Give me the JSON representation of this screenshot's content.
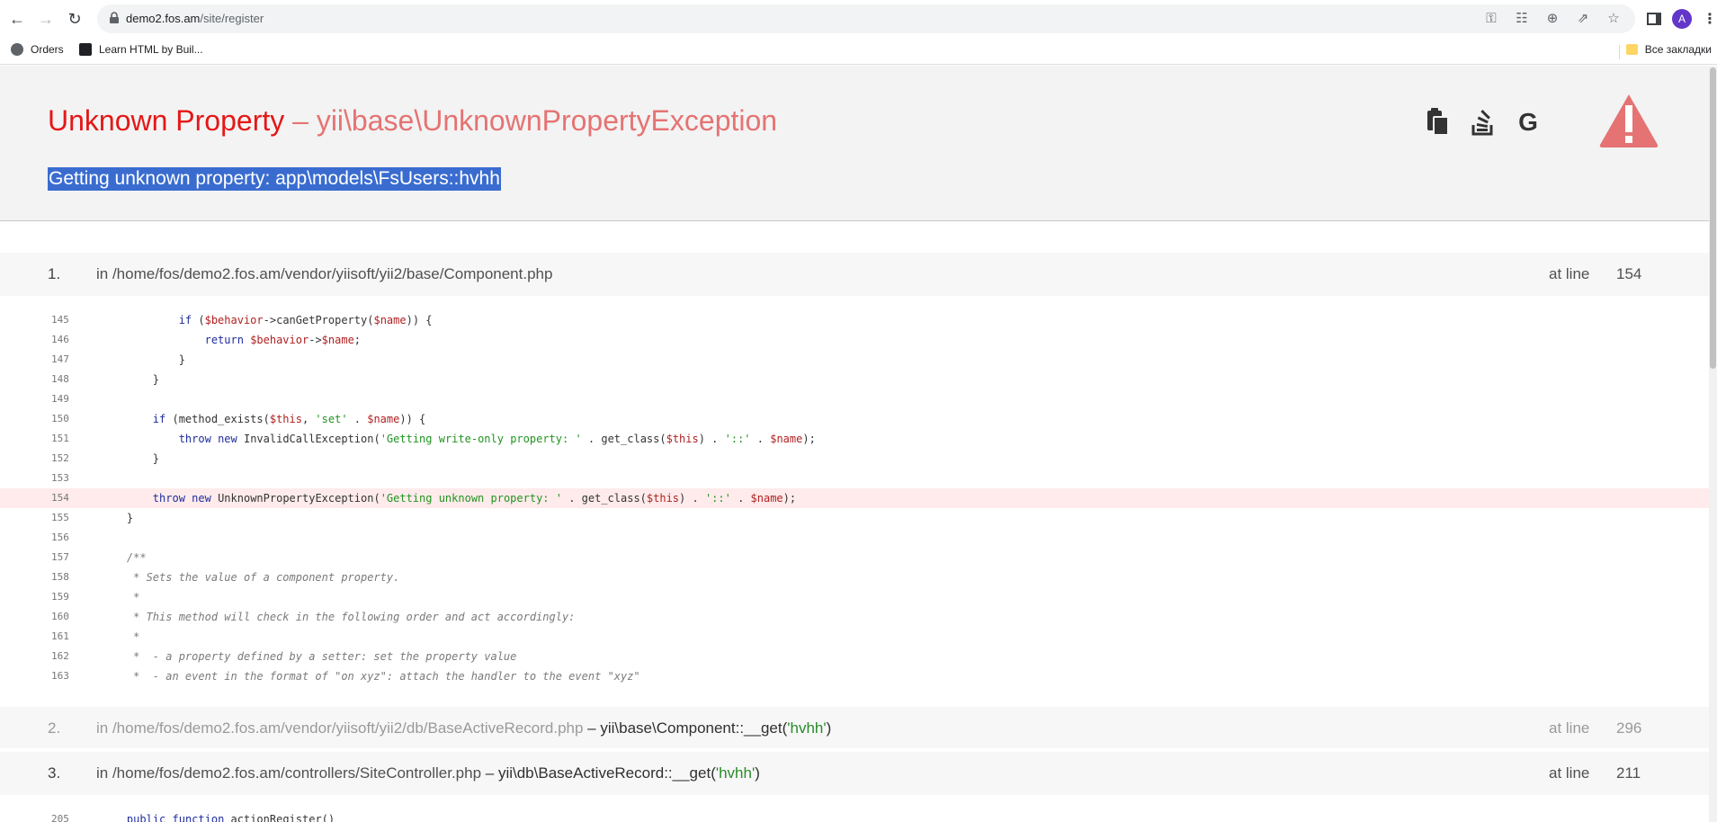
{
  "browser": {
    "url_host": "demo2.fos.am",
    "url_path": "/site/register",
    "profile_initial": "A",
    "bookmarks": [
      {
        "label": "Orders"
      },
      {
        "label": "Learn HTML by Buil..."
      }
    ],
    "all_bookmarks_label": "Все закладки"
  },
  "error": {
    "name": "Unknown Property",
    "separator": "–",
    "exception": "yii\\base\\UnknownPropertyException",
    "message": "Getting unknown property: app\\models\\FsUsers::hvhh"
  },
  "tools": {
    "copy_icon": "clipboard-icon",
    "stackoverflow_icon": "stackoverflow-icon",
    "google_icon": "google-icon",
    "google_label": "G"
  },
  "callstack": [
    {
      "num": "1.",
      "file": "in /home/fos/demo2.fos.am/vendor/yiisoft/yii2/base/Component.php",
      "fn": "",
      "arg": "",
      "at_line_label": "at line",
      "line": "154"
    },
    {
      "num": "2.",
      "file": "in /home/fos/demo2.fos.am/vendor/yiisoft/yii2/db/BaseActiveRecord.php",
      "sep": " – ",
      "fn": "yii\\base\\Component::__get(",
      "arg": "'hvhh'",
      "close": ")",
      "at_line_label": "at line",
      "line": "296"
    },
    {
      "num": "3.",
      "file": "in /home/fos/demo2.fos.am/controllers/SiteController.php",
      "sep": " – ",
      "fn": "yii\\db\\BaseActiveRecord::__get(",
      "arg": "'hvhh'",
      "close": ")",
      "at_line_label": "at line",
      "line": "211"
    }
  ],
  "code": {
    "lines": [
      "145",
      "146",
      "147",
      "148",
      "149",
      "150",
      "151",
      "152",
      "153",
      "154",
      "155",
      "156",
      "157",
      "158",
      "159",
      "160",
      "161",
      "162",
      "163"
    ],
    "last_visible_line": "205",
    "last_visible_text": "public function actionRegister()"
  }
}
